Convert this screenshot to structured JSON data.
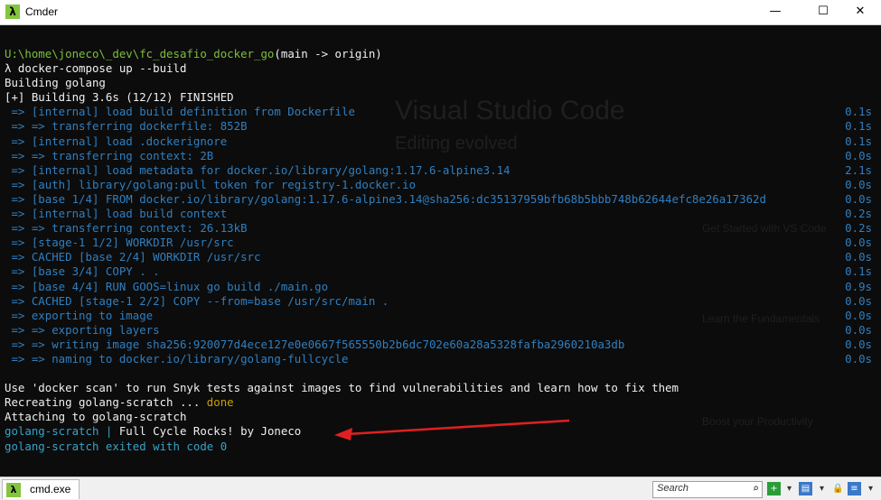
{
  "window": {
    "title": "Cmder",
    "minimize": "—",
    "maximize": "☐",
    "close": "✕"
  },
  "background_ghost": {
    "heading": "Visual Studio Code",
    "subheading": "Editing evolved",
    "item1": "Get Started with VS Code",
    "item2": "Learn the Fundamentals",
    "item3": "Boost your Productivity"
  },
  "terminal": {
    "lines": [
      {
        "text": "U:\\home\\joneco\\_dev\\fc_desafio_docker_go",
        "suffix": "(main -> origin)",
        "color": "green"
      },
      {
        "text": "λ docker-compose up --build",
        "color": "white"
      },
      {
        "text": "Building golang",
        "color": "white"
      },
      {
        "text": "[+] Building 3.6s (12/12) FINISHED",
        "color": "white"
      },
      {
        "text": " => [internal] load build definition from Dockerfile",
        "time": "0.1s",
        "color": "blue"
      },
      {
        "text": " => => transferring dockerfile: 852B",
        "time": "0.1s",
        "color": "blue"
      },
      {
        "text": " => [internal] load .dockerignore",
        "time": "0.1s",
        "color": "blue"
      },
      {
        "text": " => => transferring context: 2B",
        "time": "0.0s",
        "color": "blue"
      },
      {
        "text": " => [internal] load metadata for docker.io/library/golang:1.17.6-alpine3.14",
        "time": "2.1s",
        "color": "blue"
      },
      {
        "text": " => [auth] library/golang:pull token for registry-1.docker.io",
        "time": "0.0s",
        "color": "blue"
      },
      {
        "text": " => [base 1/4] FROM docker.io/library/golang:1.17.6-alpine3.14@sha256:dc35137959bfb68b5bbb748b62644efc8e26a17362d",
        "time": "0.0s",
        "color": "blue"
      },
      {
        "text": " => [internal] load build context",
        "time": "0.2s",
        "color": "blue"
      },
      {
        "text": " => => transferring context: 26.13kB",
        "time": "0.2s",
        "color": "blue"
      },
      {
        "text": " => [stage-1 1/2] WORKDIR /usr/src",
        "time": "0.0s",
        "color": "blue"
      },
      {
        "text": " => CACHED [base 2/4] WORKDIR /usr/src",
        "time": "0.0s",
        "color": "blue"
      },
      {
        "text": " => [base 3/4] COPY . .",
        "time": "0.1s",
        "color": "blue"
      },
      {
        "text": " => [base 4/4] RUN GOOS=linux go build ./main.go",
        "time": "0.9s",
        "color": "blue"
      },
      {
        "text": " => CACHED [stage-1 2/2] COPY --from=base /usr/src/main .",
        "time": "0.0s",
        "color": "blue"
      },
      {
        "text": " => exporting to image",
        "time": "0.0s",
        "color": "blue"
      },
      {
        "text": " => => exporting layers",
        "time": "0.0s",
        "color": "blue"
      },
      {
        "text": " => => writing image sha256:920077d4ece127e0e0667f565550b2b6dc702e60a28a5328fafba2960210a3db",
        "time": "0.0s",
        "color": "blue"
      },
      {
        "text": " => => naming to docker.io/library/golang-fullcycle",
        "time": "0.0s",
        "color": "blue"
      },
      {
        "text": "",
        "color": "white"
      },
      {
        "text": "Use 'docker scan' to run Snyk tests against images to find vulnerabilities and learn how to fix them",
        "color": "white"
      },
      {
        "text": "Recreating golang-scratch ... ",
        "suffix": "done",
        "color": "white"
      },
      {
        "text": "Attaching to golang-scratch",
        "color": "white"
      },
      {
        "text": "golang-scratch | ",
        "suffix": "Full Cycle Rocks! by Joneco",
        "color": "teal"
      },
      {
        "text": "golang-scratch exited with code 0",
        "color": "teal"
      }
    ]
  },
  "statusbar": {
    "tab_label": "cmd.exe",
    "search_placeholder": "Search"
  },
  "colors": {
    "green": "#7dbf3c",
    "blue": "#2f7fc1",
    "teal": "#35a3c9",
    "orange": "#c8a000",
    "arrow": "#e02020"
  }
}
